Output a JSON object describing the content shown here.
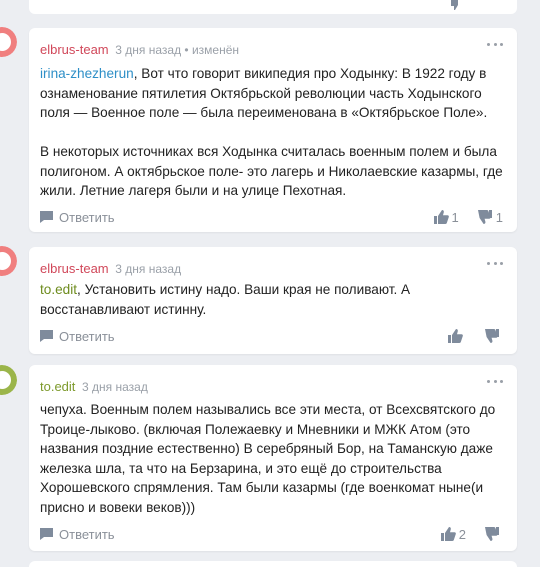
{
  "colors": {
    "background": "#eceef2",
    "card": "#ffffff",
    "author_red": "#d1485a",
    "author_green": "#7d9a2c",
    "mention_blue": "#2e8fc7",
    "mention_green": "#6e8c1e",
    "meta_gray": "#9aa0a8",
    "avatar_red": "#f07f7f",
    "avatar_green": "#9bb54a"
  },
  "comments": [
    {
      "author": "elbrus-team",
      "meta": "3 дня назад • изменён",
      "mention": "irina-zhezherun",
      "paragraphs": [
        ", Вот что говорит википедия про Ходынку: В 1922 году в ознаменование пятилетия Октябрьской революции часть Ходынского поля — Военное поле — была переименована в «Октябрьское Поле».",
        "В некоторых источниках вся Ходынка считалась военным полем и была полигоном. А октябрьское поле- это лагерь и Николаевские казармы, где жили. Летние лагеря были и на улице Пехотная."
      ],
      "reply_label": "Ответить",
      "likes": "1",
      "dislikes": "1",
      "avatar_icon": "avatar-icon"
    },
    {
      "author": "elbrus-team",
      "meta": "3 дня назад",
      "mention": "to.edit",
      "paragraphs": [
        ", Установить истину надо. Ваши края не поливают. А восстанавливают истинну."
      ],
      "reply_label": "Ответить",
      "likes": "",
      "dislikes": "",
      "avatar_icon": "avatar-icon"
    },
    {
      "author": "to.edit",
      "meta": "3 дня назад",
      "mention": "",
      "paragraphs": [
        "чепуха. Военным полем назывались все эти места, от Всехсвятского до Троице-лыково. (включая Полежаевку и Мневники и МЖК Атом (это названия поздние естественно) В серебряный Бор, на Таманскую даже железка шла, та что на Берзарина, и это ещё до строительства Хорошевского спрямления. Там были казармы (где военкомат ныне(и присно и вовеки веков)))"
      ],
      "reply_label": "Ответить",
      "likes": "2",
      "dislikes": "",
      "avatar_icon": "avatar-icon"
    }
  ]
}
